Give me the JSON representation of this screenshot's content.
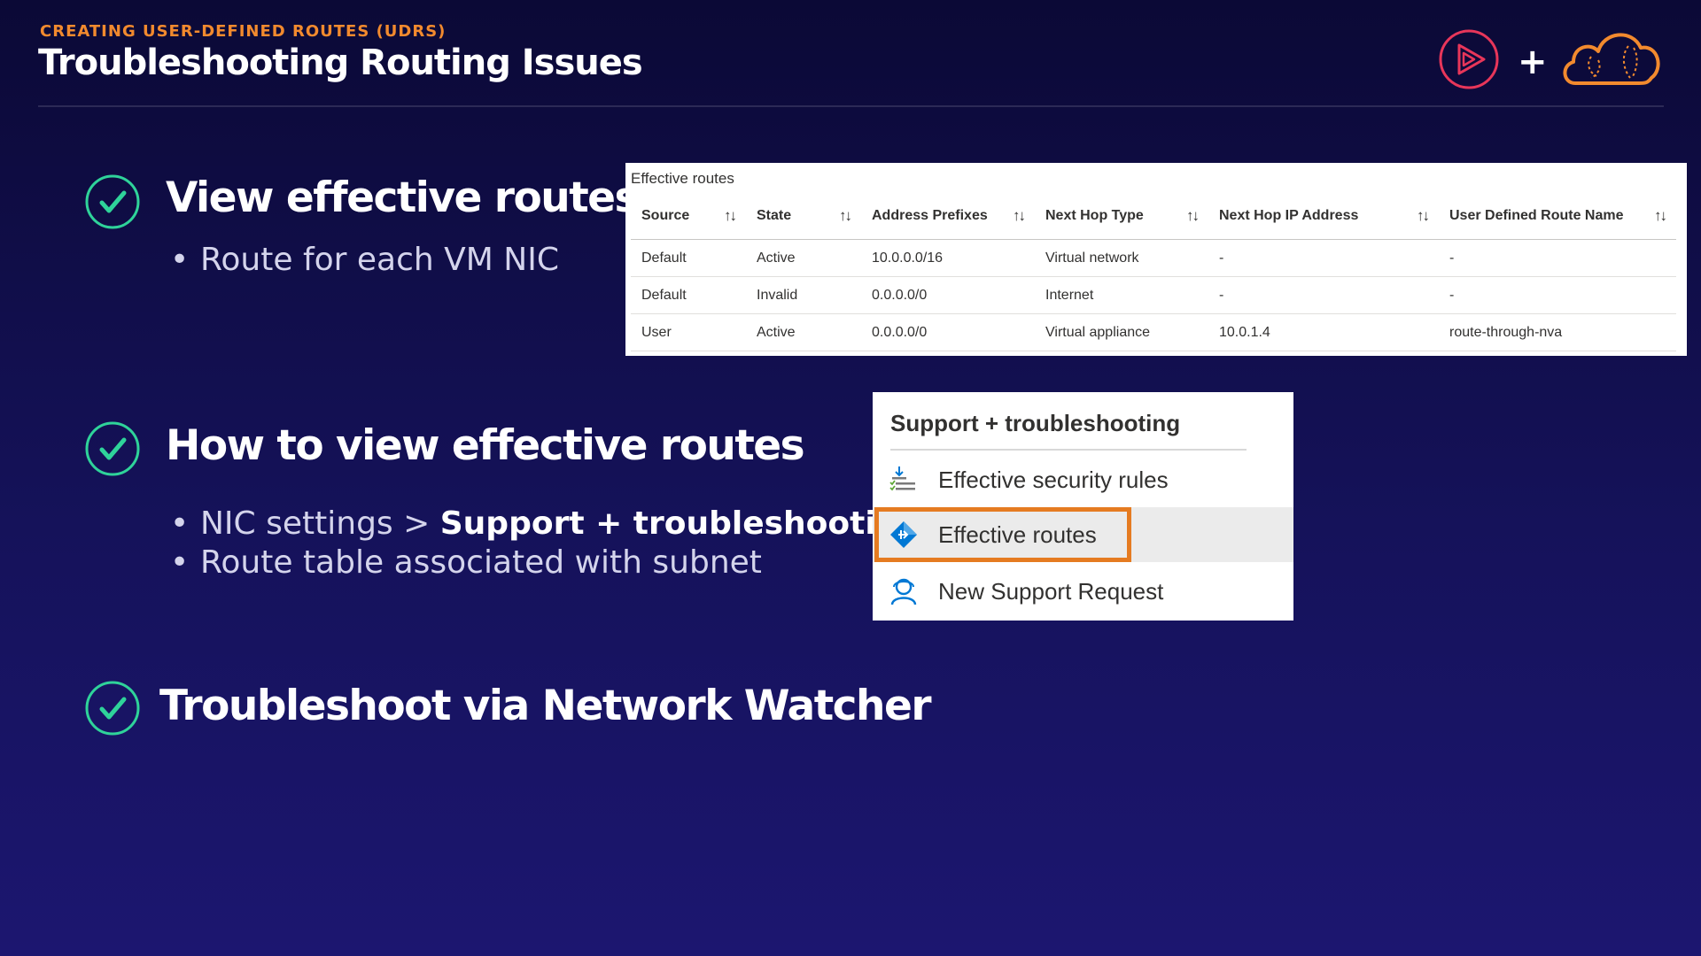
{
  "header": {
    "eyebrow": "CREATING USER-DEFINED ROUTES (UDRS)",
    "title": "Troubleshooting Routing Issues",
    "logo_plus": "+"
  },
  "sections": [
    {
      "heading": "View effective routes",
      "bullets": [
        "Route for each VM NIC"
      ]
    },
    {
      "heading": "How to view effective routes",
      "bullets": [
        {
          "prefix": "NIC settings > ",
          "bold": "Support + troubleshooting"
        },
        "Route table associated with subnet"
      ]
    },
    {
      "heading": "Troubleshoot via Network Watcher",
      "bullets": []
    }
  ],
  "routes_table": {
    "caption": "Effective routes",
    "sort_glyph": "↑↓",
    "columns": [
      "Source",
      "State",
      "Address Prefixes",
      "Next Hop Type",
      "Next Hop IP Address",
      "User Defined Route Name"
    ],
    "rows": [
      [
        "Default",
        "Active",
        "10.0.0.0/16",
        "Virtual network",
        "-",
        "-"
      ],
      [
        "Default",
        "Invalid",
        "0.0.0.0/0",
        "Internet",
        "-",
        "-"
      ],
      [
        "User",
        "Active",
        "0.0.0.0/0",
        "Virtual appliance",
        "10.0.1.4",
        "route-through-nva"
      ]
    ]
  },
  "support_menu": {
    "heading": "Support + troubleshooting",
    "items": [
      {
        "label": "Effective security rules",
        "icon": "security-rules-icon"
      },
      {
        "label": "Effective routes",
        "icon": "routes-diamond-icon",
        "selected": true
      },
      {
        "label": "New Support Request",
        "icon": "support-person-icon"
      }
    ]
  },
  "colors": {
    "accent_orange": "#f28a2e",
    "check_green": "#2fd39a",
    "highlight_orange": "#e57b21",
    "background_top": "#0b0936",
    "background_bottom": "#1c1670"
  }
}
